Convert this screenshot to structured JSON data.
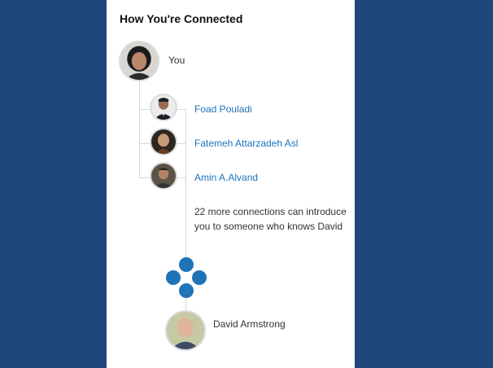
{
  "panel": {
    "title": "How You're Connected"
  },
  "you": {
    "label": "You"
  },
  "connections": [
    {
      "name": "Foad Pouladi"
    },
    {
      "name": "Fatemeh Attarzadeh Asl"
    },
    {
      "name": "Amin A.Alvand"
    }
  ],
  "more_text": "22 more connections can introduce you to someone who knows David",
  "target": {
    "name": "David Armstrong"
  },
  "colors": {
    "page_background": "#1f477a",
    "link": "#1f73b7",
    "network_icon": "#1f73b7"
  }
}
